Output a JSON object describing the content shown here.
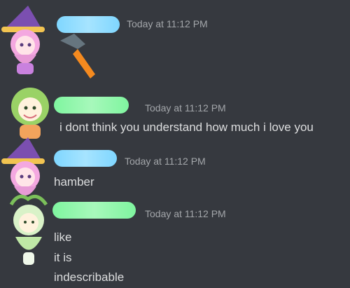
{
  "messages": [
    {
      "avatar": "witch-avatar",
      "name_color": "blue",
      "timestamp": "Today at 11:12 PM",
      "lines": [],
      "attachment": "hammer-emoji"
    },
    {
      "avatar": "green-hair-avatar",
      "name_color": "green",
      "timestamp": "Today at 11:12 PM",
      "lines": [
        "i dont think you understand how much i love you"
      ]
    },
    {
      "avatar": "witch-avatar",
      "name_color": "blue",
      "timestamp": "Today at 11:12 PM",
      "lines": [
        "hamber"
      ]
    },
    {
      "avatar": "fairy-avatar",
      "name_color": "green",
      "timestamp": "Today at 11:12 PM",
      "lines": [
        "like",
        "it is",
        "indescribable"
      ]
    }
  ]
}
